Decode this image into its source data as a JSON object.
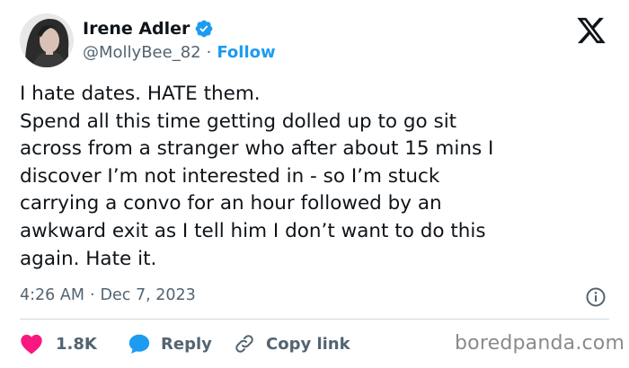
{
  "author": {
    "display_name": "Irene Adler",
    "handle": "@MollyBee_82",
    "separator": "·",
    "follow_label": "Follow",
    "verified_color": "#1d9bf0"
  },
  "icons": {
    "brand": "x-logo-icon",
    "verified": "verified-badge-icon",
    "info": "info-icon",
    "like": "heart-icon",
    "reply": "speech-bubble-icon",
    "copy": "link-icon"
  },
  "tweet": {
    "lines": [
      "I hate dates. HATE them.",
      "Spend all this time getting dolled up to go sit",
      "across from a stranger who after about 15 mins I",
      "discover I’m not interested in - so I’m stuck",
      "carrying a convo for an hour followed by an",
      "awkward exit as I tell him I don’t want to do this",
      "again. Hate it."
    ],
    "time": "4:26 AM",
    "separator": "·",
    "date": "Dec 7, 2023"
  },
  "actions": {
    "like_count": "1.8K",
    "reply_label": "Reply",
    "copy_label": "Copy link",
    "like_color": "#f91880",
    "reply_color": "#1d9bf0",
    "copy_color": "#536471"
  },
  "watermark": "boredpanda.com"
}
